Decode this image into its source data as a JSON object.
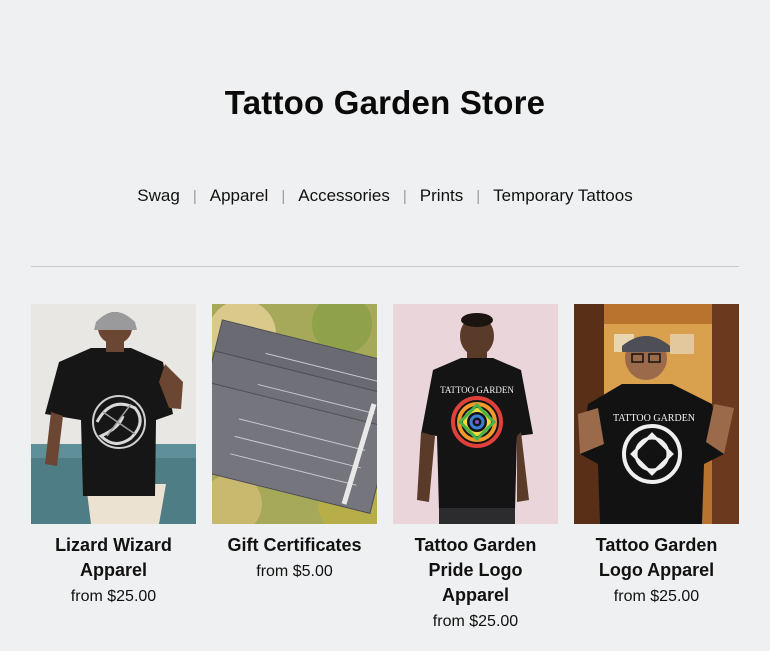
{
  "store": {
    "title": "Tattoo Garden Store"
  },
  "nav": {
    "items": [
      "Swag",
      "Apparel",
      "Accessories",
      "Prints",
      "Temporary Tattoos"
    ],
    "separator": "|"
  },
  "products": [
    {
      "name": "Lizard Wizard Apparel",
      "price": "from $25.00"
    },
    {
      "name": "Gift Certificates",
      "price": "from $5.00"
    },
    {
      "name": "Tattoo Garden Pride Logo Apparel",
      "price": "from $25.00",
      "shirt_text": "TATTOO GARDEN"
    },
    {
      "name": "Tattoo Garden Logo Apparel",
      "price": "from $25.00",
      "shirt_text": "TATTOO GARDEN"
    }
  ],
  "colors": {
    "background": "#eff0f1",
    "text": "#111111",
    "divider": "#c7c8ca"
  }
}
